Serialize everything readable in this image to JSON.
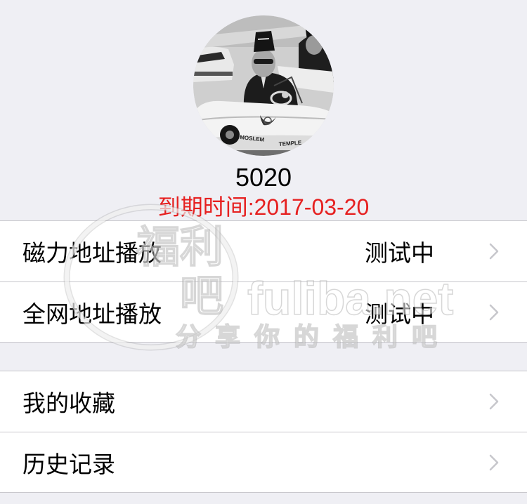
{
  "header": {
    "avatar": {
      "icon": "user-avatar-photo",
      "car_text": [
        "MOSLEM",
        "TEMPLE"
      ]
    },
    "username": "5020",
    "expiry": "到期时间:2017-03-20"
  },
  "colors": {
    "background": "#efeff4",
    "row_background": "#ffffff",
    "expiry_text": "#e62020",
    "separator": "#c8c7cc",
    "chevron": "#c7c7cc",
    "text": "#000000"
  },
  "menu_groups": [
    {
      "items": [
        {
          "label": "磁力地址播放",
          "value": "测试中",
          "icon": "chevron-right-icon"
        },
        {
          "label": "全网地址播放",
          "value": "测试中",
          "icon": "chevron-right-icon"
        }
      ]
    },
    {
      "items": [
        {
          "label": "我的收藏",
          "icon": "chevron-right-icon"
        },
        {
          "label": "历史记录",
          "icon": "chevron-right-icon"
        }
      ]
    }
  ],
  "watermark": {
    "logo_text": "福利吧",
    "domain": "fuliba.net",
    "slogan": "分享你的福利吧"
  }
}
